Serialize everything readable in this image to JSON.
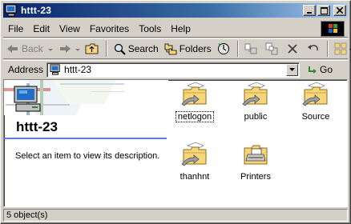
{
  "window": {
    "title": "httt-23"
  },
  "menubar": {
    "items": [
      {
        "label": "File"
      },
      {
        "label": "Edit"
      },
      {
        "label": "View"
      },
      {
        "label": "Favorites"
      },
      {
        "label": "Tools"
      },
      {
        "label": "Help"
      }
    ]
  },
  "toolbar": {
    "back_label": "Back",
    "search_label": "Search",
    "folders_label": "Folders"
  },
  "address": {
    "label": "Address",
    "value": "httt-23",
    "go_label": "Go"
  },
  "left_panel": {
    "folder_title": "httt-23",
    "description": "Select an item to view its description."
  },
  "items": [
    {
      "label": "netlogon",
      "icon": "shared-folder-icon"
    },
    {
      "label": "public",
      "icon": "shared-folder-icon"
    },
    {
      "label": "Source",
      "icon": "shared-folder-icon"
    },
    {
      "label": "thanhnt",
      "icon": "shared-folder-icon"
    },
    {
      "label": "Printers",
      "icon": "printers-folder-icon"
    }
  ],
  "status": {
    "text": "5 object(s)"
  },
  "colors": {
    "title_active": "#0a246a",
    "title_gradient_end": "#a6caf0",
    "chrome": "#d4d0c8",
    "folder_yellow": "#f6d57b",
    "panel_rule": "#5a7edc"
  }
}
